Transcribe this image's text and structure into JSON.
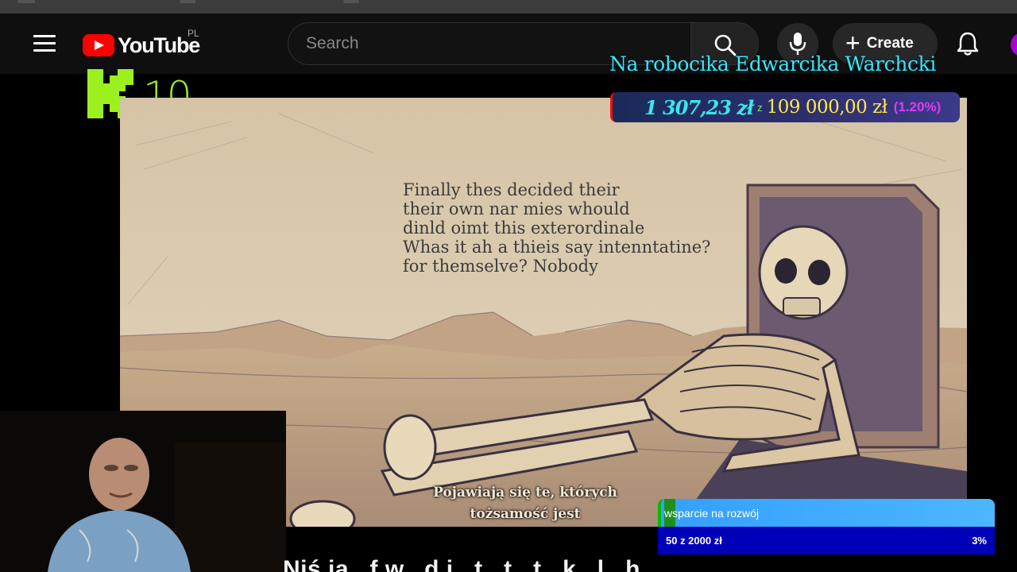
{
  "header": {
    "logo_text": "YouTube",
    "country_code": "PL",
    "search_placeholder": "Search",
    "create_label": "Create",
    "icons": [
      "menu-icon",
      "search-icon",
      "mic-icon",
      "plus-icon",
      "bell-icon"
    ]
  },
  "overlay": {
    "k_count": "10",
    "goal_title": "Na robocika Edwarcika Warchcki",
    "goal_raised": "1 307,23 zł",
    "goal_separator": "z",
    "goal_target": "109 000,00 zł",
    "goal_percent": "(1.20%)",
    "goal_progress_fraction": 0.012
  },
  "video": {
    "image_text": "Finally thes decided their\ntheir own nar mies whould\ndinld oimt this exterordinale\nWhas it ah a thieis say intenntatine?\nfor themselve? Nobody",
    "subtitle": "Pojawiają się te, których\ntożsamość jest"
  },
  "support_widget": {
    "title": "wsparcie na rozwój",
    "amount": "50 z 2000 zł",
    "percent": "3%",
    "progress_fraction": 0.03
  },
  "page": {
    "video_title_partial": "Niś ja...f w...d i...t...t...t...k...l...h"
  },
  "colors": {
    "accent_green": "#9bf01e",
    "goal_cyan": "#37e8ef",
    "goal_yellow": "#ffe94a",
    "goal_magenta": "#e03cf0",
    "youtube_red": "#ff0000",
    "support_blue": "#0000b8"
  }
}
